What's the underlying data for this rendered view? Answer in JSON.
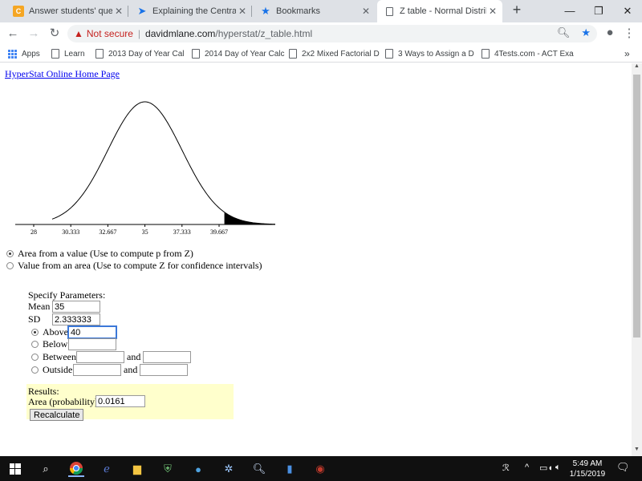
{
  "browser": {
    "tabs": [
      {
        "title": "Answer students' questio",
        "favicon": "chegg-icon",
        "active": false
      },
      {
        "title": "Explaining the Central Lin",
        "favicon": "arrow-icon",
        "active": false
      },
      {
        "title": "Bookmarks",
        "favicon": "star-icon",
        "active": false
      },
      {
        "title": "Z table - Normal Distribu",
        "favicon": "page-icon",
        "active": true
      }
    ],
    "address": {
      "warning": "Not secure",
      "host": "davidmlane.com",
      "path": "/hyperstat/z_table.html"
    },
    "bookmarks": [
      {
        "label": "Apps"
      },
      {
        "label": "Learn"
      },
      {
        "label": "2013 Day of Year Cal"
      },
      {
        "label": "2014 Day of Year Calc"
      },
      {
        "label": "2x2 Mixed Factorial D"
      },
      {
        "label": "3 Ways to Assign a D"
      },
      {
        "label": "4Tests.com - ACT Exa"
      }
    ],
    "bookmarks_overflow": "»"
  },
  "page": {
    "home_link": "HyperStat Online Home Page",
    "chart_data": {
      "type": "area",
      "x_ticks": [
        "28",
        "30.333",
        "32.667",
        "35",
        "37.333",
        "39.667"
      ],
      "mean": 35,
      "sd": 2.333333,
      "shaded_region": "above",
      "shaded_from": 40
    },
    "mode_options": [
      {
        "label": "Area from a value (Use to compute p from Z)",
        "selected": true
      },
      {
        "label": "Value from an area (Use to compute Z for confidence intervals)",
        "selected": false
      }
    ],
    "params": {
      "heading": "Specify Parameters:",
      "mean_label": "Mean",
      "mean_value": "35",
      "sd_label": "SD",
      "sd_value": "2.333333",
      "above_label": "Above",
      "above_value": "40",
      "below_label": "Below",
      "below_value": "",
      "between_label": "Between",
      "between_and": "and",
      "outside_label": "Outside",
      "outside_and": "and",
      "selected": "above"
    },
    "results": {
      "heading": "Results:",
      "area_label": "Area (probability)",
      "area_value": "0.0161",
      "button": "Recalculate"
    }
  },
  "taskbar": {
    "time": "5:49 AM",
    "date": "1/15/2019"
  },
  "colors": {
    "tabbar": "#dee1e6",
    "link": "#0000ee",
    "results_bg": "#ffffcc",
    "warning": "#c5221f"
  }
}
